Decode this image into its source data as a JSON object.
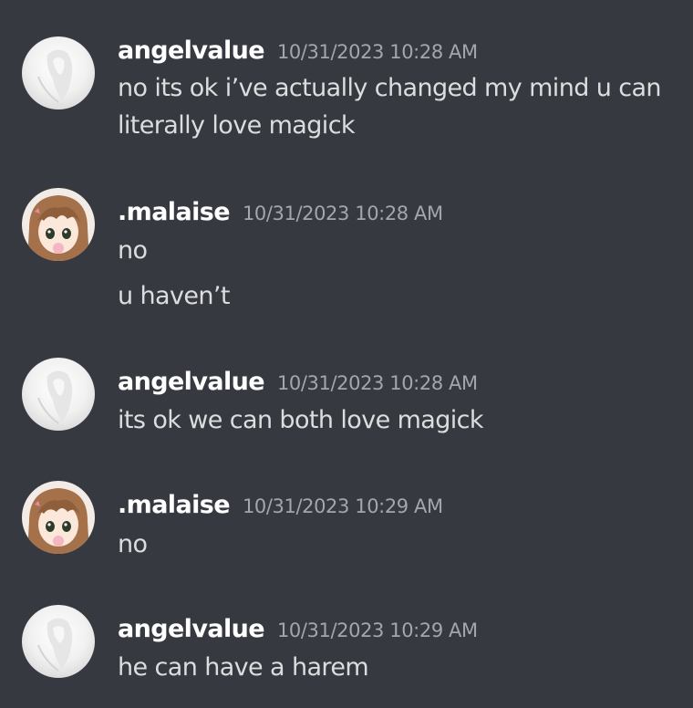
{
  "messages": [
    {
      "username": "angelvalue",
      "timestamp": "10/31/2023 10:28 AM",
      "lines": [
        "no its ok i’ve actually changed my mind u can",
        "literally love magick"
      ]
    },
    {
      "username": ".malaise",
      "timestamp": "10/31/2023 10:28 AM",
      "lines": [
        "no",
        "u haven’t"
      ]
    },
    {
      "username": "angelvalue",
      "timestamp": "10/31/2023 10:28 AM",
      "lines": [
        "its ok we can both love magick"
      ]
    },
    {
      "username": ".malaise",
      "timestamp": "10/31/2023 10:29 AM",
      "lines": [
        "no"
      ]
    },
    {
      "username": "angelvalue",
      "timestamp": "10/31/2023 10:29 AM",
      "lines": [
        "he can have a harem"
      ]
    }
  ],
  "colors": {
    "background": "#36393f",
    "username": "#ffffff",
    "timestamp": "#a3a6aa",
    "message_text": "#dcddde"
  },
  "icons": {
    "angelvalue_avatar": "white-haired-figure-avatar-icon",
    "malaise_avatar": "brown-haired-anime-girl-avatar-icon"
  }
}
